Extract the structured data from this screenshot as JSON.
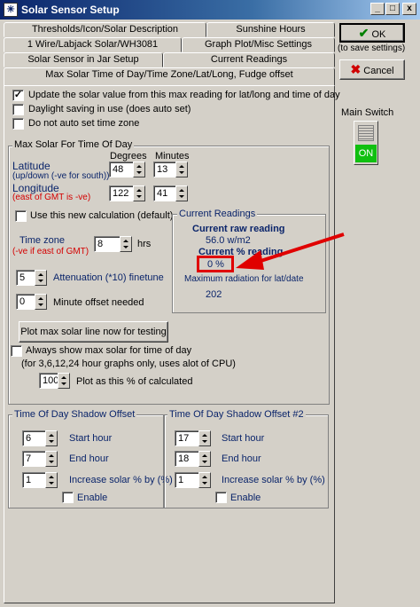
{
  "window": {
    "title": "Solar Sensor Setup",
    "icon": "app-icon",
    "min": "_",
    "max": "□",
    "close": "x"
  },
  "tabs": {
    "row1": [
      "Thresholds/Icon/Solar Description",
      "Sunshine Hours"
    ],
    "row2": [
      "1 Wire/Labjack Solar/WH3081",
      "Graph Plot/Misc Settings"
    ],
    "row3": [
      "Solar Sensor in Jar Setup",
      "Current Readings"
    ],
    "active": "Max Solar Time of Day/Time Zone/Lat/Long, Fudge offset"
  },
  "buttons": {
    "ok": "OK",
    "ok_hint": "(to save settings)",
    "cancel": "Cancel",
    "plot": "Plot max solar line now for testing"
  },
  "main_switch": {
    "label": "Main Switch",
    "state": "ON",
    "color": "#10c010"
  },
  "options": {
    "update": "Update the solar value from this max reading for lat/long and time of day",
    "update_checked": "✓",
    "dst": "Daylight saving in use (does auto set)",
    "no_tz": "Do not auto set time zone"
  },
  "maxsolar": {
    "title": "Max Solar For Time Of Day",
    "degrees_hdr": "Degrees",
    "minutes_hdr": "Minutes",
    "lat_label": "Latitude",
    "lat_sub": "(up/down (-ve for south))",
    "lat_deg": "48",
    "lat_min": "13",
    "lon_label": "Longitude",
    "lon_sub": "(east of GMT is -ve)",
    "lon_deg": "122",
    "lon_min": "41",
    "newcalc": "Use this new calculation (default)",
    "tz_label": "Time zone",
    "tz_sub": "(-ve if east of GMT)",
    "tz_value": "8",
    "tz_unit": "hrs",
    "atten_value": "5",
    "atten_label": "Attenuation (*10) finetune",
    "minoff_value": "0",
    "minoff_label": "Minute offset needed"
  },
  "readings": {
    "title": "Current Readings",
    "raw_hdr": "Current raw reading",
    "raw_value": "56.0 w/m2",
    "pct_hdr": "Current % reading",
    "pct_value": "0 %",
    "max_hdr": "Maximum radiation for lat/date",
    "max_value": "202"
  },
  "always": {
    "label": "Always show max solar for time of day",
    "note": "(for 3,6,12,24 hour graphs only, uses alot of CPU)",
    "pct_value": "100",
    "pct_label": "Plot as this % of calculated"
  },
  "shadow1": {
    "title": "Time Of Day Shadow Offset",
    "start": "6",
    "start_label": "Start hour",
    "end": "7",
    "end_label": "End hour",
    "inc": "1",
    "inc_label": "Increase solar % by (%)",
    "enable": "Enable"
  },
  "shadow2": {
    "title": "Time Of Day Shadow Offset #2",
    "start": "17",
    "start_label": "Start hour",
    "end": "18",
    "end_label": "End hour",
    "inc": "1",
    "inc_label": "Increase solar % by (%)",
    "enable": "Enable"
  },
  "annotation": {
    "highlight_color": "#e00000"
  }
}
